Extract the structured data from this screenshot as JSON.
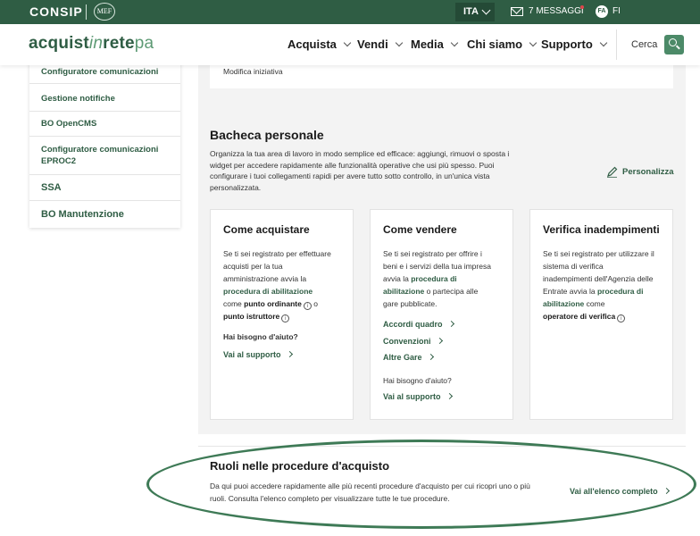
{
  "topbar": {
    "logo": "CONSIP",
    "mef": "MEF",
    "lang": "ITA",
    "messages": "7 MESSAGGI",
    "avatar_initials": "FA",
    "user": "FI"
  },
  "header": {
    "brand_a": "acquist",
    "brand_in": "in",
    "brand_rete": "rete",
    "brand_pa": "pa",
    "nav": [
      "Acquista",
      "Vendi",
      "Media",
      "Chi siamo",
      "Supporto"
    ],
    "search_label": "Cerca"
  },
  "sidebar": {
    "items": [
      "Configuratore comunicazioni",
      "Gestione notifiche",
      "BO OpenCMS",
      "Configuratore comunicazioni EPROC2",
      "SSA",
      "BO Manutenzione"
    ]
  },
  "main": {
    "modifica": "Modifica iniziativa",
    "bacheca_title": "Bacheca personale",
    "bacheca_desc": "Organizza la tua area di lavoro in modo semplice ed efficace: aggiungi, rimuovi o sposta i widget per accedere rapidamente alle funzionalità operative che usi più spesso. Puoi configurare i tuoi collegamenti rapidi per avere tutto sotto controllo, in un'unica vista personalizzata.",
    "personalizza": "Personalizza"
  },
  "cards": {
    "acquistare": {
      "title": "Come acquistare",
      "l1": "Se ti sei registrato per effettuare",
      "l2": "acquisti per la tua",
      "l3": "amministrazione avvia la",
      "l4": "procedura di abilitazione",
      "l5a": "come ",
      "l5b": "punto ordinante",
      "l5c": " o",
      "l6": "punto istruttore",
      "help": "Hai bisogno d'aiuto?",
      "support": "Vai al supporto"
    },
    "vendere": {
      "title": "Come vendere",
      "l1": "Se ti sei registrato per offrire i",
      "l2": "beni e i servizi della tua impresa",
      "l3a": "avvia la ",
      "l3b": "procedura di",
      "l4a": "abilitazione",
      "l4b": " o partecipa alle",
      "l5": "gare pubblicate.",
      "link1": "Accordi quadro",
      "link2": "Convenzioni",
      "link3": "Altre Gare",
      "help": "Hai bisogno d'aiuto?",
      "support": "Vai al supporto"
    },
    "verifica": {
      "title": "Verifica inadempimenti",
      "l1": "Se ti sei registrato per utilizzare il",
      "l2": "sistema di verifica",
      "l3": "inadempimenti dell'Agenzia delle",
      "l4a": "Entrate avvia la ",
      "l4b": "procedura di",
      "l5a": "abilitazione",
      "l5b": " come",
      "l6": "operatore di verifica"
    }
  },
  "ruoli": {
    "title": "Ruoli nelle procedure d'acquisto",
    "desc": "Da qui puoi accedere rapidamente alle più recenti procedure d'acquisto per cui ricopri uno o più ruoli. Consulta l'elenco completo per visualizzare tutte le tue procedure.",
    "link": "Vai all'elenco completo"
  },
  "colors": {
    "brand_green": "#2f5d44",
    "accent_green": "#4c8a68",
    "notification_dot": "#e0474c"
  }
}
